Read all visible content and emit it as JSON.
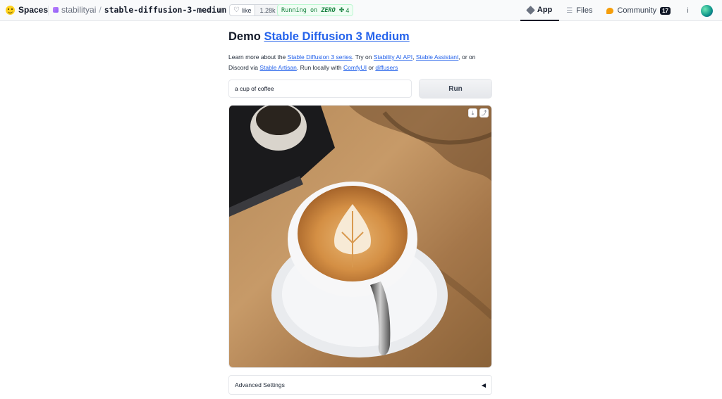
{
  "header": {
    "logo_text": "Spaces",
    "org": "stabilityai",
    "separator": "/",
    "repo": "stable-diffusion-3-medium",
    "like_label": "like",
    "like_count": "1.28k",
    "running_label": "Running on",
    "running_hardware": "ZERO",
    "running_count": "4",
    "nav": {
      "app": "App",
      "files": "Files",
      "community": "Community",
      "community_count": "17"
    },
    "info_icon_label": "i"
  },
  "main": {
    "title_prefix": "Demo",
    "title_link": "Stable Diffusion 3 Medium",
    "desc": {
      "t1": "Learn more about the ",
      "l1": "Stable Diffusion 3 series",
      "t2": ". Try on ",
      "l2": "Stability AI API",
      "t3": ", ",
      "l3": "Stable Assistant",
      "t4": ", or on Discord via ",
      "l4": "Stable Artisan",
      "t5": ". Run locally with ",
      "l5": "ComfyUI",
      "t6": " or ",
      "l6": "diffusers"
    },
    "prompt_value": "a cup of coffee",
    "run_label": "Run",
    "advanced_label": "Advanced Settings",
    "advanced_caret": "◀",
    "download_glyph": "⤓",
    "share_glyph": "⤴"
  },
  "colors": {
    "link": "#2563eb",
    "running_bg": "#f0fdf4",
    "running_text": "#15803d",
    "brand": "#ffd21e"
  }
}
